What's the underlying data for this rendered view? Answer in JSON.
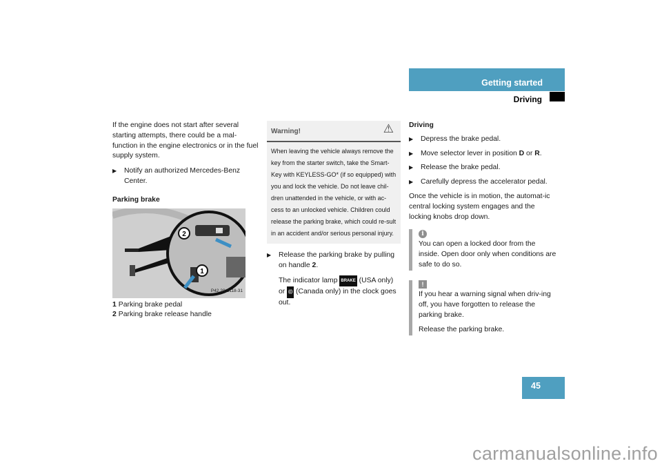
{
  "header": {
    "section": "Getting started",
    "subsection": "Driving"
  },
  "col1": {
    "intro": "If the engine does not start after several starting attempts, there could be a mal-function in the engine electronics or in the fuel supply system.",
    "bullet": "Notify an authorized Mercedes-Benz Center.",
    "heading": "Parking brake",
    "figure_code": "P42.20-2118-31",
    "callouts": [
      "1",
      "2"
    ],
    "captions": [
      {
        "num": "1",
        "text": "Parking brake pedal"
      },
      {
        "num": "2",
        "text": "Parking brake release handle"
      }
    ]
  },
  "warning": {
    "title": "Warning!",
    "icon": "warning-triangle-icon",
    "body": "When leaving the vehicle always remove the key from the starter switch, take the Smart-Key with KEYLESS-GO* (if so equipped) with you and lock the vehicle. Do not leave chil-dren unattended in the vehicle, or with ac-cess to an unlocked vehicle. Children could release the parking brake, which could re-sult in an accident and/or serious personal injury."
  },
  "col2": {
    "bullet_pre": "Release the parking brake by pulling on handle ",
    "bullet_bold": "2",
    "bullet_post": ".",
    "lamp_pre": "The indicator lamp ",
    "lamp_usa_label": "BRAKE",
    "lamp_usa_suffix": " (USA only) or ",
    "lamp_canada_label": "(()",
    "lamp_canada_suffix": " (Canada only) in the clock goes out."
  },
  "col3": {
    "heading": "Driving",
    "bullets": [
      {
        "pre": "Depress the brake pedal.",
        "b1": "",
        "mid": "",
        "b2": "",
        "post": ""
      },
      {
        "pre": "Move selector lever in position ",
        "b1": "D",
        "mid": " or ",
        "b2": "R",
        "post": "."
      },
      {
        "pre": "Release the brake pedal.",
        "b1": "",
        "mid": "",
        "b2": "",
        "post": ""
      },
      {
        "pre": "Carefully depress the accelerator pedal.",
        "b1": "",
        "mid": "",
        "b2": "",
        "post": ""
      }
    ],
    "para": "Once the vehicle is in motion, the automat-ic central locking system engages and the locking knobs drop down.",
    "info_note": "You can open a locked door from the inside. Open door only when conditions are safe to do so.",
    "alert_note": "If you hear a warning signal when driv-ing off, you have forgotten to release the parking brake.",
    "alert_note2": "Release the parking brake."
  },
  "page_number": "45",
  "watermark": "carmanualsonline.info",
  "colors": {
    "accent": "#4f9fc0",
    "note_bar": "#a8a8a8"
  }
}
